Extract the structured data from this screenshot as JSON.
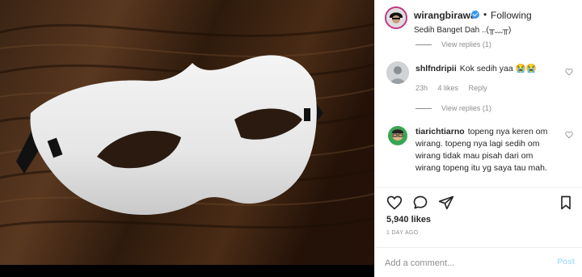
{
  "post": {
    "image_alt": "white masquerade mask on wooden surface"
  },
  "header": {
    "username": "wirangbirawa",
    "separator": "•",
    "follow_label": "Following",
    "subtitle": "Sedih Banget Dah ..(╥﹏╥)"
  },
  "comments": {
    "view_replies_1": "View replies (1)",
    "items": [
      {
        "username": "shlfndripii",
        "text": "Kok sedih yaa 😭😭",
        "age": "23h",
        "likes": "4 likes",
        "reply": "Reply"
      },
      {
        "username": "tiarichtiarno",
        "text": "topeng nya keren om wirang. topeng nya lagi sedih om wirang tidak mau pisah dari om wirang topeng itu yg saya tau mah."
      }
    ],
    "view_replies_2": "View replies (1)"
  },
  "actions": {
    "like_icon": "heart-icon",
    "comment_icon": "comment-icon",
    "share_icon": "share-icon",
    "save_icon": "bookmark-icon"
  },
  "stats": {
    "likes": "5,940 likes",
    "time": "1 DAY AGO"
  },
  "add_comment": {
    "placeholder": "Add a comment...",
    "post_label": "Post"
  }
}
